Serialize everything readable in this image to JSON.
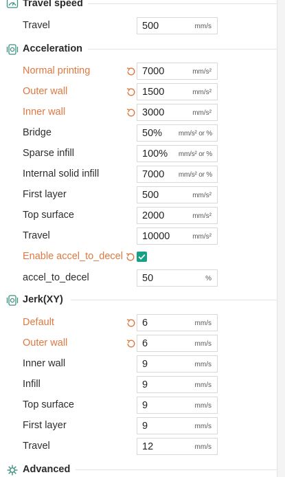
{
  "colors": {
    "modified": "#e0773f",
    "accent": "#16a085",
    "text": "#2d2d2d"
  },
  "sections": {
    "travel_speed": {
      "title": "Travel speed",
      "icon": "speedometer-icon"
    },
    "acceleration": {
      "title": "Acceleration",
      "icon": "acceleration-icon"
    },
    "jerk": {
      "title": "Jerk(XY)",
      "icon": "jerk-icon"
    },
    "advanced": {
      "title": "Advanced",
      "icon": "advanced-icon"
    }
  },
  "travel_speed": {
    "travel": {
      "label": "Travel",
      "value": "500",
      "unit": "mm/s"
    }
  },
  "acceleration": {
    "normal_printing": {
      "label": "Normal printing",
      "value": "7000",
      "unit": "mm/s²",
      "modified": true
    },
    "outer_wall": {
      "label": "Outer wall",
      "value": "1500",
      "unit": "mm/s²",
      "modified": true
    },
    "inner_wall": {
      "label": "Inner wall",
      "value": "3000",
      "unit": "mm/s²",
      "modified": true
    },
    "bridge": {
      "label": "Bridge",
      "value": "50%",
      "unit": "mm/s² or %"
    },
    "sparse_infill": {
      "label": "Sparse infill",
      "value": "100%",
      "unit": "mm/s² or %"
    },
    "internal_solid_infill": {
      "label": "Internal solid infill",
      "value": "7000",
      "unit": "mm/s² or %"
    },
    "first_layer": {
      "label": "First layer",
      "value": "500",
      "unit": "mm/s²"
    },
    "top_surface": {
      "label": "Top surface",
      "value": "2000",
      "unit": "mm/s²"
    },
    "travel": {
      "label": "Travel",
      "value": "10000",
      "unit": "mm/s²"
    },
    "enable_accel_to_decel": {
      "label": "Enable accel_to_decel",
      "checked": true,
      "modified": true
    },
    "accel_to_decel": {
      "label": "accel_to_decel",
      "value": "50",
      "unit": "%"
    }
  },
  "jerk": {
    "default": {
      "label": "Default",
      "value": "6",
      "unit": "mm/s",
      "modified": true
    },
    "outer_wall": {
      "label": "Outer wall",
      "value": "6",
      "unit": "mm/s",
      "modified": true
    },
    "inner_wall": {
      "label": "Inner wall",
      "value": "9",
      "unit": "mm/s"
    },
    "infill": {
      "label": "Infill",
      "value": "9",
      "unit": "mm/s"
    },
    "top_surface": {
      "label": "Top surface",
      "value": "9",
      "unit": "mm/s"
    },
    "first_layer": {
      "label": "First layer",
      "value": "9",
      "unit": "mm/s"
    },
    "travel": {
      "label": "Travel",
      "value": "12",
      "unit": "mm/s"
    }
  }
}
